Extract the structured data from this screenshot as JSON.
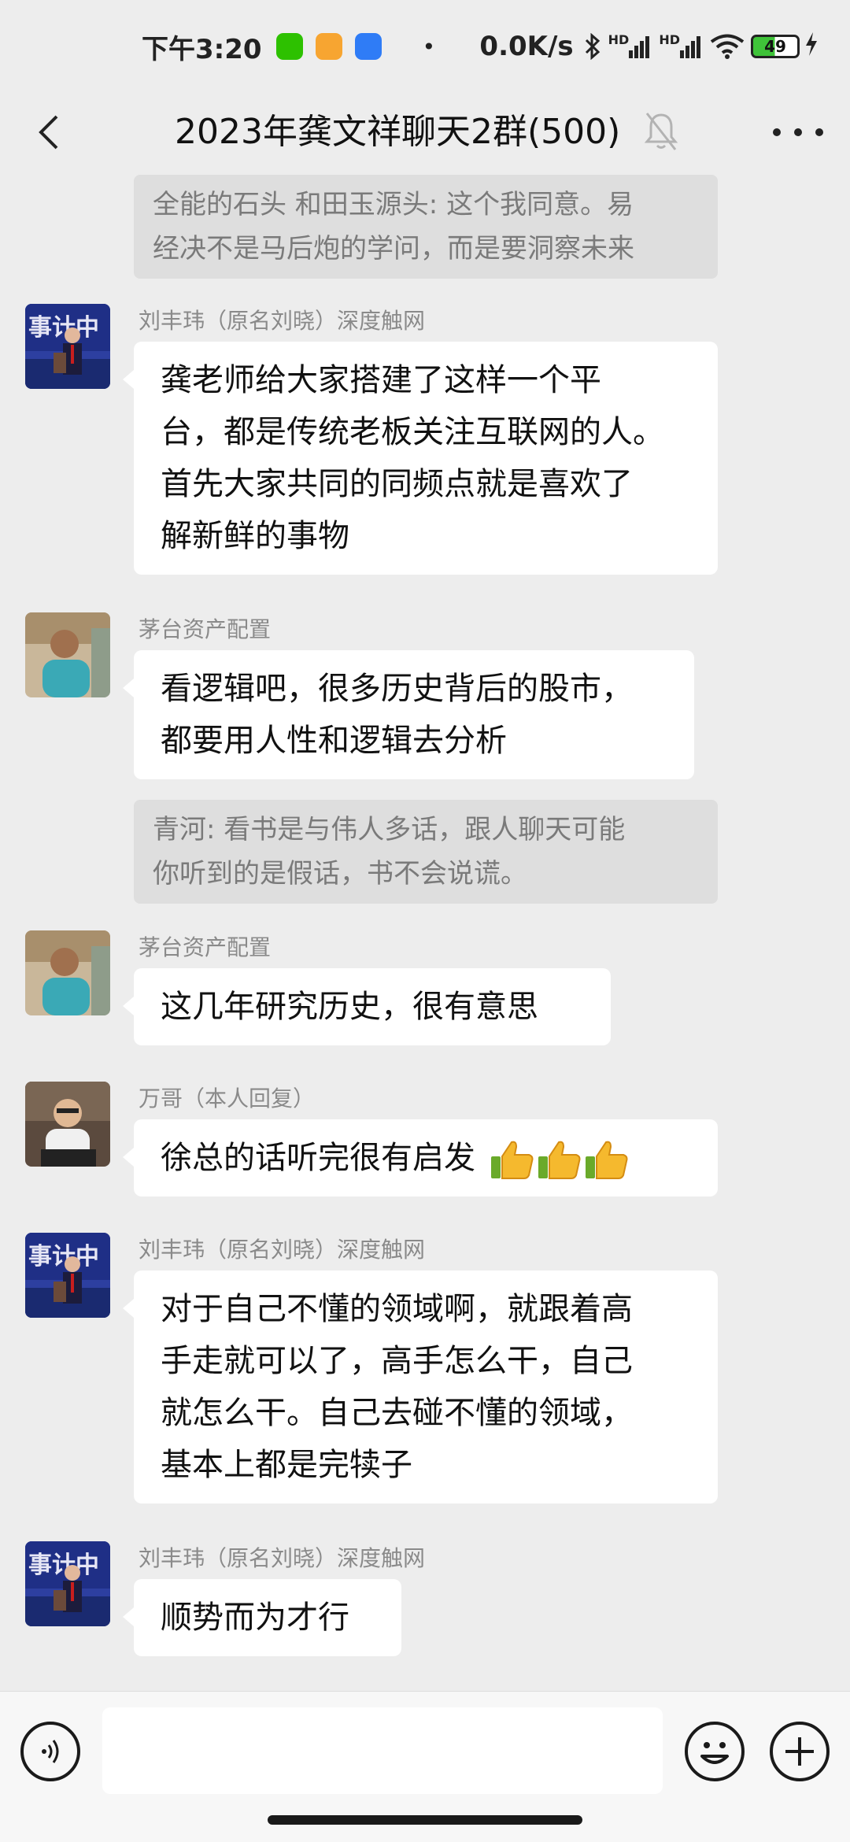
{
  "status_bar": {
    "time": "下午3:20",
    "dot": "•",
    "net_speed": "0.0K/s",
    "sig1_label": "HD",
    "sig2_label": "HD",
    "battery": "49"
  },
  "header": {
    "title": "2023年龚文祥聊天2群(500)"
  },
  "messages": [
    {
      "type": "quote",
      "text_line1": "全能的石头 和田玉源头: 这个我同意。易",
      "text_line2": "经决不是马后炮的学问，而是要洞察未来"
    },
    {
      "type": "msg",
      "sender": "刘丰玮（原名刘晓）深度触网",
      "lines": [
        "龚老师给大家搭建了这样一个平",
        "台，都是传统老板关注互联网的人。",
        "首先大家共同的同频点就是喜欢了",
        "解新鲜的事物"
      ]
    },
    {
      "type": "msg",
      "sender": "茅台资产配置",
      "lines": [
        "看逻辑吧，很多历史背后的股市，",
        "都要用人性和逻辑去分析"
      ]
    },
    {
      "type": "quote",
      "text_line1": "青河: 看书是与伟人多话，跟人聊天可能",
      "text_line2": "你听到的是假话，书不会说谎。"
    },
    {
      "type": "msg",
      "sender": "茅台资产配置",
      "lines": [
        "这几年研究历史，很有意思"
      ]
    },
    {
      "type": "msg",
      "sender": "万哥（本人回复）",
      "lines": [
        "徐总的话听完很有启发"
      ]
    },
    {
      "type": "msg",
      "sender": "刘丰玮（原名刘晓）深度触网",
      "lines": [
        "对于自己不懂的领域啊，就跟着高",
        "手走就可以了，高手怎么干，自己",
        "就怎么干。自己去碰不懂的领域，",
        "基本上都是完犊子"
      ]
    },
    {
      "type": "msg",
      "sender": "刘丰玮（原名刘晓）深度触网",
      "lines": [
        "顺势而为才行"
      ]
    }
  ],
  "input": {
    "placeholder": ""
  },
  "colors": {
    "background": "#ededed",
    "bubble": "#ffffff",
    "quote_bg": "#dedede",
    "sender_text": "#8a8a8a",
    "wechat_green": "#2dc100"
  },
  "icons": {
    "back": "chevron-left-icon",
    "mute": "bell-off-icon",
    "more": "more-dots-icon",
    "voice": "voice-icon",
    "emoji": "emoji-icon",
    "plus": "plus-icon"
  }
}
